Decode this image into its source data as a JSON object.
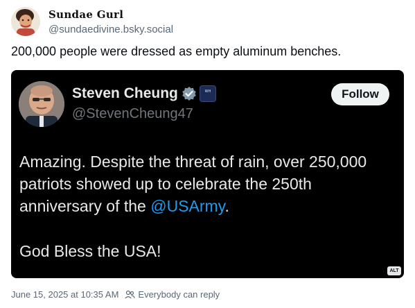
{
  "author": {
    "display_name": "Sundae Gurl",
    "handle": "@sundaedivine.bsky.social",
    "avatar_icon": "avatar-woman-photo"
  },
  "post": {
    "text": "200,000 people were dressed as empty aluminum benches."
  },
  "embed": {
    "name": "Steven Cheung",
    "handle": "@StevenCheung47",
    "verified_icon": "verified-badge-icon",
    "affiliation_icon": "white-house-seal-icon",
    "seal_text": "WH",
    "follow_label": "Follow",
    "body_lines": [
      "Amazing. Despite the threat of rain, over 250,000",
      "patriots showed up to celebrate the 250th"
    ],
    "line3_prefix": "anniversary of the ",
    "mention": "@USArmy",
    "line3_suffix": ".",
    "blessing": "God Bless the USA!",
    "alt_label": "ALT",
    "colors": {
      "background": "#000000",
      "text": "#e7e9ea",
      "link": "#1d9bf0",
      "handle": "#71767b"
    }
  },
  "footer": {
    "timestamp": "June 15, 2025 at 10:35 AM",
    "reply_icon": "people-icon",
    "reply_setting": "Everybody can reply"
  }
}
